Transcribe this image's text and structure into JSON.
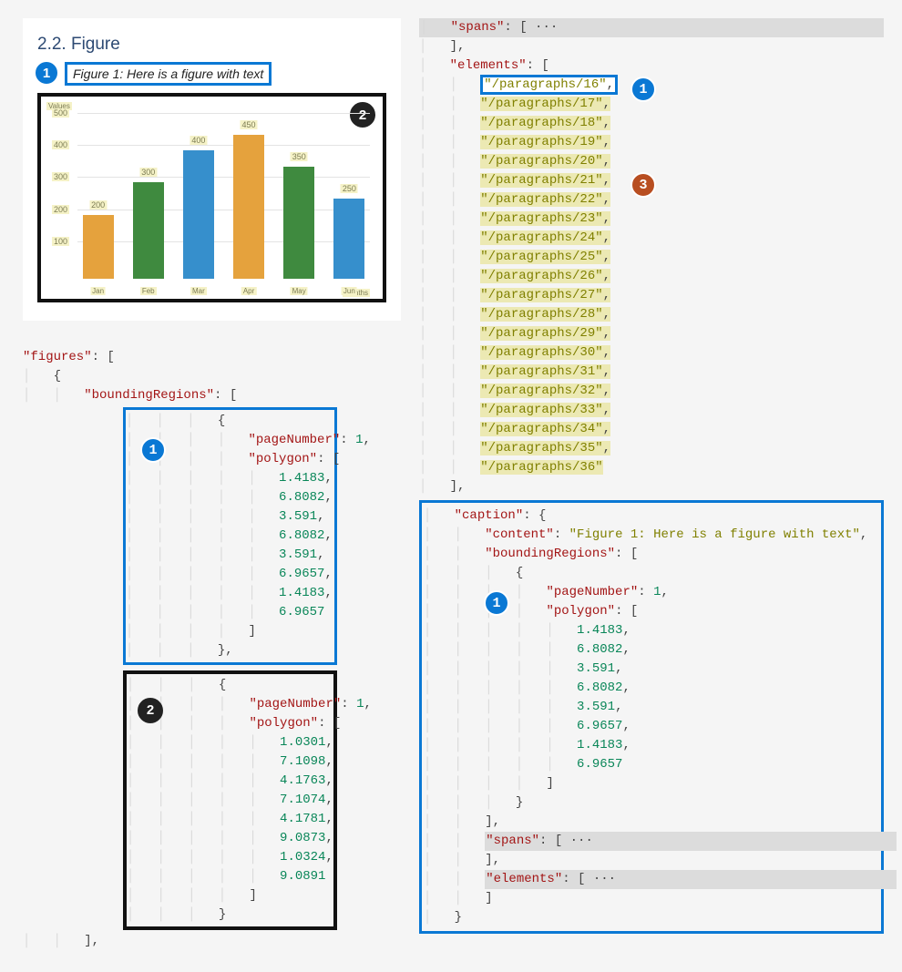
{
  "doc": {
    "section_title": "2.2. Figure",
    "caption_text": "Figure 1: Here is a figure with text"
  },
  "badges": {
    "b1": "1",
    "b2": "2",
    "b3": "3"
  },
  "chart_data": {
    "type": "bar",
    "categories": [
      "Jan",
      "Feb",
      "Mar",
      "Apr",
      "May",
      "Jun"
    ],
    "values": [
      200,
      300,
      400,
      450,
      350,
      250
    ],
    "colors": [
      "orange",
      "green",
      "blue",
      "orange",
      "green",
      "blue"
    ],
    "ylabel": "Values",
    "xlabel": "Months",
    "ylim": [
      0,
      500
    ],
    "yticks": [
      100,
      200,
      300,
      400,
      500
    ]
  },
  "json_left": {
    "root_key": "\"figures\"",
    "br_key": "\"boundingRegions\"",
    "region1": {
      "pageKey": "\"pageNumber\"",
      "pageVal": "1",
      "polyKey": "\"polygon\"",
      "coords": [
        "1.4183",
        "6.8082",
        "3.591",
        "6.8082",
        "3.591",
        "6.9657",
        "1.4183",
        "6.9657"
      ]
    },
    "region2": {
      "pageKey": "\"pageNumber\"",
      "pageVal": "1",
      "polyKey": "\"polygon\"",
      "coords": [
        "1.0301",
        "7.1098",
        "4.1763",
        "7.1074",
        "4.1781",
        "9.0873",
        "1.0324",
        "9.0891"
      ]
    }
  },
  "json_right": {
    "spans_key": "\"spans\"",
    "elements_key": "\"elements\"",
    "element_first": "\"/paragraphs/16\"",
    "elements_rest": [
      "\"/paragraphs/17\"",
      "\"/paragraphs/18\"",
      "\"/paragraphs/19\"",
      "\"/paragraphs/20\"",
      "\"/paragraphs/21\"",
      "\"/paragraphs/22\"",
      "\"/paragraphs/23\"",
      "\"/paragraphs/24\"",
      "\"/paragraphs/25\"",
      "\"/paragraphs/26\"",
      "\"/paragraphs/27\"",
      "\"/paragraphs/28\"",
      "\"/paragraphs/29\"",
      "\"/paragraphs/30\"",
      "\"/paragraphs/31\"",
      "\"/paragraphs/32\"",
      "\"/paragraphs/33\"",
      "\"/paragraphs/34\"",
      "\"/paragraphs/35\"",
      "\"/paragraphs/36\""
    ],
    "caption_key": "\"caption\"",
    "content_key": "\"content\"",
    "content_val": "\"Figure 1: Here is a figure with text\"",
    "br_key": "\"boundingRegions\"",
    "pageKey": "\"pageNumber\"",
    "pageVal": "1",
    "polyKey": "\"polygon\"",
    "coords": [
      "1.4183",
      "6.8082",
      "3.591",
      "6.8082",
      "3.591",
      "6.9657",
      "1.4183",
      "6.9657"
    ]
  }
}
